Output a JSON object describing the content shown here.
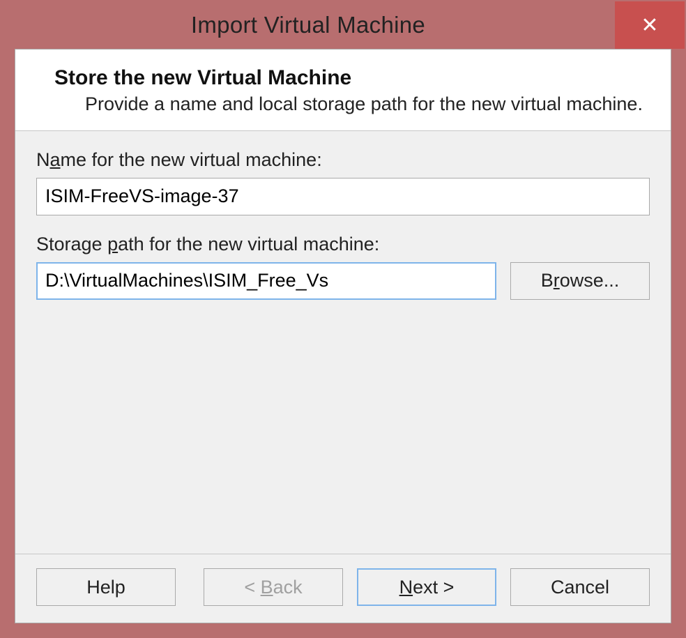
{
  "window": {
    "title": "Import Virtual Machine",
    "close_glyph": "✕"
  },
  "header": {
    "heading": "Store the new Virtual Machine",
    "subheading": "Provide a name and local storage path for the new virtual machine."
  },
  "form": {
    "name_label_pre": "N",
    "name_label_ul": "a",
    "name_label_post": "me for the new virtual machine:",
    "name_value": "ISIM-FreeVS-image-37",
    "path_label_pre": "Storage ",
    "path_label_ul": "p",
    "path_label_post": "ath for the new virtual machine:",
    "path_value": "D:\\VirtualMachines\\ISIM_Free_Vs",
    "browse_pre": "B",
    "browse_ul": "r",
    "browse_post": "owse..."
  },
  "footer": {
    "help": "Help",
    "back_pre": "< ",
    "back_ul": "B",
    "back_post": "ack",
    "next_ul": "N",
    "next_post": "ext >",
    "cancel": "Cancel"
  }
}
